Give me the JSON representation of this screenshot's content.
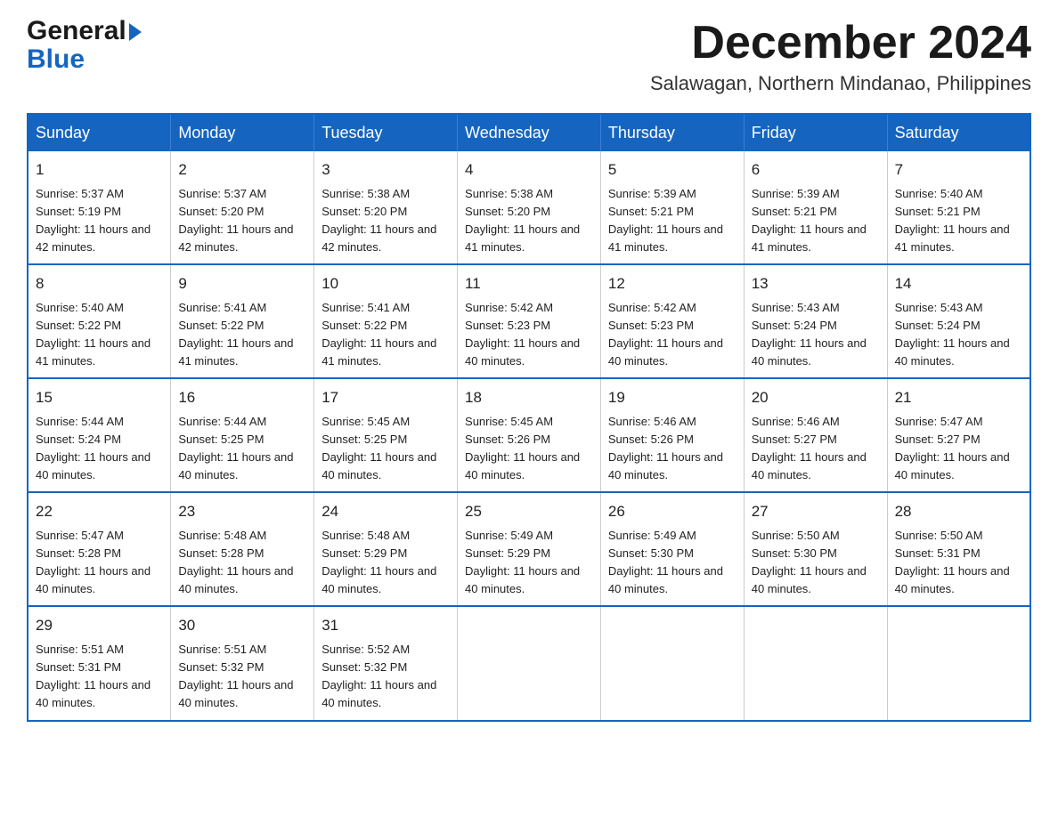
{
  "header": {
    "logo_general": "General",
    "logo_blue": "Blue",
    "month_title": "December 2024",
    "subtitle": "Salawagan, Northern Mindanao, Philippines"
  },
  "days_of_week": [
    "Sunday",
    "Monday",
    "Tuesday",
    "Wednesday",
    "Thursday",
    "Friday",
    "Saturday"
  ],
  "weeks": [
    [
      {
        "day": "1",
        "sunrise": "Sunrise: 5:37 AM",
        "sunset": "Sunset: 5:19 PM",
        "daylight": "Daylight: 11 hours and 42 minutes."
      },
      {
        "day": "2",
        "sunrise": "Sunrise: 5:37 AM",
        "sunset": "Sunset: 5:20 PM",
        "daylight": "Daylight: 11 hours and 42 minutes."
      },
      {
        "day": "3",
        "sunrise": "Sunrise: 5:38 AM",
        "sunset": "Sunset: 5:20 PM",
        "daylight": "Daylight: 11 hours and 42 minutes."
      },
      {
        "day": "4",
        "sunrise": "Sunrise: 5:38 AM",
        "sunset": "Sunset: 5:20 PM",
        "daylight": "Daylight: 11 hours and 41 minutes."
      },
      {
        "day": "5",
        "sunrise": "Sunrise: 5:39 AM",
        "sunset": "Sunset: 5:21 PM",
        "daylight": "Daylight: 11 hours and 41 minutes."
      },
      {
        "day": "6",
        "sunrise": "Sunrise: 5:39 AM",
        "sunset": "Sunset: 5:21 PM",
        "daylight": "Daylight: 11 hours and 41 minutes."
      },
      {
        "day": "7",
        "sunrise": "Sunrise: 5:40 AM",
        "sunset": "Sunset: 5:21 PM",
        "daylight": "Daylight: 11 hours and 41 minutes."
      }
    ],
    [
      {
        "day": "8",
        "sunrise": "Sunrise: 5:40 AM",
        "sunset": "Sunset: 5:22 PM",
        "daylight": "Daylight: 11 hours and 41 minutes."
      },
      {
        "day": "9",
        "sunrise": "Sunrise: 5:41 AM",
        "sunset": "Sunset: 5:22 PM",
        "daylight": "Daylight: 11 hours and 41 minutes."
      },
      {
        "day": "10",
        "sunrise": "Sunrise: 5:41 AM",
        "sunset": "Sunset: 5:22 PM",
        "daylight": "Daylight: 11 hours and 41 minutes."
      },
      {
        "day": "11",
        "sunrise": "Sunrise: 5:42 AM",
        "sunset": "Sunset: 5:23 PM",
        "daylight": "Daylight: 11 hours and 40 minutes."
      },
      {
        "day": "12",
        "sunrise": "Sunrise: 5:42 AM",
        "sunset": "Sunset: 5:23 PM",
        "daylight": "Daylight: 11 hours and 40 minutes."
      },
      {
        "day": "13",
        "sunrise": "Sunrise: 5:43 AM",
        "sunset": "Sunset: 5:24 PM",
        "daylight": "Daylight: 11 hours and 40 minutes."
      },
      {
        "day": "14",
        "sunrise": "Sunrise: 5:43 AM",
        "sunset": "Sunset: 5:24 PM",
        "daylight": "Daylight: 11 hours and 40 minutes."
      }
    ],
    [
      {
        "day": "15",
        "sunrise": "Sunrise: 5:44 AM",
        "sunset": "Sunset: 5:24 PM",
        "daylight": "Daylight: 11 hours and 40 minutes."
      },
      {
        "day": "16",
        "sunrise": "Sunrise: 5:44 AM",
        "sunset": "Sunset: 5:25 PM",
        "daylight": "Daylight: 11 hours and 40 minutes."
      },
      {
        "day": "17",
        "sunrise": "Sunrise: 5:45 AM",
        "sunset": "Sunset: 5:25 PM",
        "daylight": "Daylight: 11 hours and 40 minutes."
      },
      {
        "day": "18",
        "sunrise": "Sunrise: 5:45 AM",
        "sunset": "Sunset: 5:26 PM",
        "daylight": "Daylight: 11 hours and 40 minutes."
      },
      {
        "day": "19",
        "sunrise": "Sunrise: 5:46 AM",
        "sunset": "Sunset: 5:26 PM",
        "daylight": "Daylight: 11 hours and 40 minutes."
      },
      {
        "day": "20",
        "sunrise": "Sunrise: 5:46 AM",
        "sunset": "Sunset: 5:27 PM",
        "daylight": "Daylight: 11 hours and 40 minutes."
      },
      {
        "day": "21",
        "sunrise": "Sunrise: 5:47 AM",
        "sunset": "Sunset: 5:27 PM",
        "daylight": "Daylight: 11 hours and 40 minutes."
      }
    ],
    [
      {
        "day": "22",
        "sunrise": "Sunrise: 5:47 AM",
        "sunset": "Sunset: 5:28 PM",
        "daylight": "Daylight: 11 hours and 40 minutes."
      },
      {
        "day": "23",
        "sunrise": "Sunrise: 5:48 AM",
        "sunset": "Sunset: 5:28 PM",
        "daylight": "Daylight: 11 hours and 40 minutes."
      },
      {
        "day": "24",
        "sunrise": "Sunrise: 5:48 AM",
        "sunset": "Sunset: 5:29 PM",
        "daylight": "Daylight: 11 hours and 40 minutes."
      },
      {
        "day": "25",
        "sunrise": "Sunrise: 5:49 AM",
        "sunset": "Sunset: 5:29 PM",
        "daylight": "Daylight: 11 hours and 40 minutes."
      },
      {
        "day": "26",
        "sunrise": "Sunrise: 5:49 AM",
        "sunset": "Sunset: 5:30 PM",
        "daylight": "Daylight: 11 hours and 40 minutes."
      },
      {
        "day": "27",
        "sunrise": "Sunrise: 5:50 AM",
        "sunset": "Sunset: 5:30 PM",
        "daylight": "Daylight: 11 hours and 40 minutes."
      },
      {
        "day": "28",
        "sunrise": "Sunrise: 5:50 AM",
        "sunset": "Sunset: 5:31 PM",
        "daylight": "Daylight: 11 hours and 40 minutes."
      }
    ],
    [
      {
        "day": "29",
        "sunrise": "Sunrise: 5:51 AM",
        "sunset": "Sunset: 5:31 PM",
        "daylight": "Daylight: 11 hours and 40 minutes."
      },
      {
        "day": "30",
        "sunrise": "Sunrise: 5:51 AM",
        "sunset": "Sunset: 5:32 PM",
        "daylight": "Daylight: 11 hours and 40 minutes."
      },
      {
        "day": "31",
        "sunrise": "Sunrise: 5:52 AM",
        "sunset": "Sunset: 5:32 PM",
        "daylight": "Daylight: 11 hours and 40 minutes."
      },
      null,
      null,
      null,
      null
    ]
  ],
  "accent_color": "#1565c0"
}
